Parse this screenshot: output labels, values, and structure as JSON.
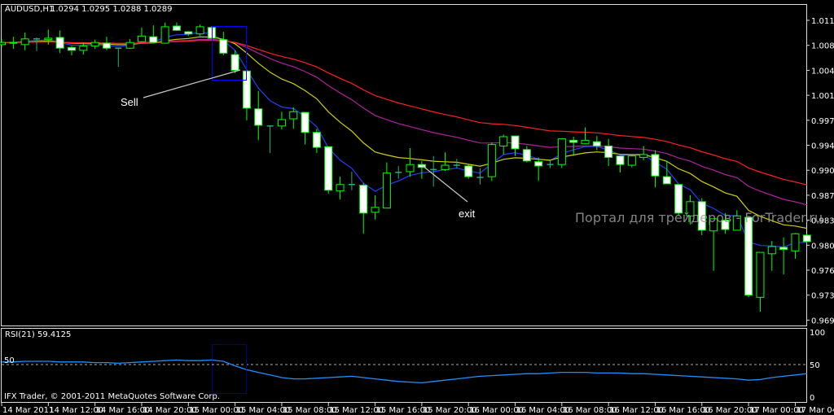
{
  "header": {
    "symbol": "AUDUSD,H1",
    "quote": "1.0294 1.0295 1.0288 1.0289"
  },
  "annotations": {
    "sell": "Sell",
    "exit": "exit"
  },
  "watermark": "Портал для трейдеров - ForTrader.ru",
  "copyright": "IFX Trader, © 2001-2011 MetaQuotes Software Corp.",
  "rsi_panel": {
    "label": "RSI(21) 59.4125",
    "level_label": "50",
    "axis": [
      "100",
      "50",
      "0"
    ]
  },
  "colors": {
    "bull": "#00ff00",
    "bear_fill": "#ffffff",
    "doji": "#20b080",
    "ma_fast": "#2040ff",
    "ma_mid": "#d0d000",
    "ma_slow": "#ff2020",
    "ma_slower": "#b020a0",
    "rsi": "#1e90ff",
    "box": "#0000ff"
  },
  "chart_data": {
    "type": "candlestick",
    "title": "AUDUSD,H1",
    "ylim": [
      0.968,
      1.0135
    ],
    "y_ticks": [
      "1.0115",
      "1.0080",
      "1.0045",
      "1.0010",
      "0.9975",
      "0.9940",
      "0.9905",
      "0.9870",
      "0.9835",
      "0.9800",
      "0.9765",
      "0.9730",
      "0.9695"
    ],
    "x_ticks": [
      "14 Mar 2011",
      "14 Mar 12:00",
      "14 Mar 16:00",
      "14 Mar 20:00",
      "15 Mar 00:00",
      "15 Mar 04:00",
      "15 Mar 08:00",
      "15 Mar 12:00",
      "15 Mar 16:00",
      "15 Mar 20:00",
      "16 Mar 00:00",
      "16 Mar 04:00",
      "16 Mar 08:00",
      "16 Mar 12:00",
      "16 Mar 16:00",
      "16 Mar 20:00",
      "17 Mar 00:00",
      "17 Mar 04:00"
    ],
    "bars_per_tick": 4,
    "ohlc": [
      [
        1.0081,
        1.0089,
        1.0077,
        1.0084
      ],
      [
        1.0083,
        1.0092,
        1.0075,
        1.0084
      ],
      [
        1.0081,
        1.0098,
        1.0073,
        1.0089
      ],
      [
        1.0089,
        1.0091,
        1.0072,
        1.0089
      ],
      [
        1.0088,
        1.0102,
        1.0081,
        1.009
      ],
      [
        1.0091,
        1.0101,
        1.0069,
        1.0076
      ],
      [
        1.0077,
        1.0079,
        1.0066,
        1.0073
      ],
      [
        1.0073,
        1.0084,
        1.0067,
        1.0079
      ],
      [
        1.0079,
        1.0088,
        1.0075,
        1.0084
      ],
      [
        1.0083,
        1.0092,
        1.0073,
        1.0076
      ],
      [
        1.0076,
        1.0076,
        1.005,
        1.0076
      ],
      [
        1.0076,
        1.0089,
        1.0075,
        1.0084
      ],
      [
        1.0085,
        1.0105,
        1.0084,
        1.0093
      ],
      [
        1.0092,
        1.0108,
        1.0083,
        1.0084
      ],
      [
        1.0083,
        1.0112,
        1.0083,
        1.0106
      ],
      [
        1.0107,
        1.0112,
        1.01,
        1.0101
      ],
      [
        1.0099,
        1.01,
        1.0093,
        1.0096
      ],
      [
        1.0096,
        1.0109,
        1.0093,
        1.0106
      ],
      [
        1.0105,
        1.0107,
        1.0089,
        1.009
      ],
      [
        1.0088,
        1.0099,
        1.0066,
        1.0069
      ],
      [
        1.0067,
        1.0073,
        1.0041,
        1.0045
      ],
      [
        1.0044,
        1.0044,
        0.9975,
        0.9992
      ],
      [
        0.9991,
        1.0016,
        0.9947,
        0.9968
      ],
      [
        0.9967,
        0.9967,
        0.9929,
        0.9967
      ],
      [
        0.9967,
        0.9987,
        0.9962,
        0.9976
      ],
      [
        0.9977,
        0.9993,
        0.9963,
        0.9987
      ],
      [
        0.9986,
        0.9986,
        0.9941,
        0.9958
      ],
      [
        0.9958,
        0.9963,
        0.9929,
        0.9937
      ],
      [
        0.9938,
        0.9938,
        0.9872,
        0.9877
      ],
      [
        0.9876,
        0.9896,
        0.9864,
        0.9885
      ],
      [
        0.9885,
        0.9903,
        0.9877,
        0.9885
      ],
      [
        0.9884,
        0.9887,
        0.9816,
        0.9845
      ],
      [
        0.9846,
        0.987,
        0.9836,
        0.9853
      ],
      [
        0.9852,
        0.9916,
        0.9852,
        0.9901
      ],
      [
        0.9902,
        0.9911,
        0.9893,
        0.9902
      ],
      [
        0.9903,
        0.9936,
        0.9896,
        0.9913
      ],
      [
        0.9913,
        0.9918,
        0.9893,
        0.9909
      ],
      [
        0.9906,
        0.9925,
        0.9882,
        0.9906
      ],
      [
        0.9906,
        0.993,
        0.9904,
        0.9912
      ],
      [
        0.9912,
        0.9921,
        0.9908,
        0.9912
      ],
      [
        0.9911,
        0.9913,
        0.9893,
        0.9896
      ],
      [
        0.9895,
        0.9908,
        0.9885,
        0.9895
      ],
      [
        0.9896,
        0.9944,
        0.989,
        0.9941
      ],
      [
        0.9939,
        0.9955,
        0.9927,
        0.9952
      ],
      [
        0.9953,
        0.9953,
        0.9925,
        0.9935
      ],
      [
        0.9934,
        0.9939,
        0.9916,
        0.9918
      ],
      [
        0.9917,
        0.9923,
        0.989,
        0.9911
      ],
      [
        0.9913,
        0.9919,
        0.9908,
        0.9913
      ],
      [
        0.9913,
        0.995,
        0.9908,
        0.9949
      ],
      [
        0.9947,
        0.9952,
        0.9925,
        0.9944
      ],
      [
        0.9942,
        0.9965,
        0.9942,
        0.9947
      ],
      [
        0.9945,
        0.9953,
        0.9933,
        0.9939
      ],
      [
        0.9939,
        0.9949,
        0.9911,
        0.9923
      ],
      [
        0.9925,
        0.9925,
        0.9902,
        0.9913
      ],
      [
        0.9912,
        0.9925,
        0.9909,
        0.9925
      ],
      [
        0.9923,
        0.9939,
        0.9919,
        0.9927
      ],
      [
        0.9927,
        0.9933,
        0.9881,
        0.9897
      ],
      [
        0.9896,
        0.9918,
        0.9886,
        0.9886
      ],
      [
        0.9885,
        0.9885,
        0.9841,
        0.9845
      ],
      [
        0.9841,
        0.987,
        0.9829,
        0.9861
      ],
      [
        0.9861,
        0.9866,
        0.9814,
        0.9821
      ],
      [
        0.982,
        0.9837,
        0.9764,
        0.9837
      ],
      [
        0.9835,
        0.9845,
        0.9816,
        0.9822
      ],
      [
        0.9821,
        0.9849,
        0.9821,
        0.9841
      ],
      [
        0.9839,
        0.9841,
        0.9727,
        0.973
      ],
      [
        0.9727,
        0.979,
        0.9707,
        0.979
      ],
      [
        0.9788,
        0.9806,
        0.9764,
        0.9798
      ],
      [
        0.9797,
        0.9811,
        0.9759,
        0.9794
      ],
      [
        0.9792,
        0.9817,
        0.9781,
        0.9816
      ],
      [
        0.9814,
        0.9816,
        0.9805,
        0.9805
      ]
    ],
    "moving_averages": [
      {
        "period": 5,
        "color_key": "ma_fast"
      },
      {
        "period": 13,
        "color_key": "ma_mid"
      },
      {
        "period": 26,
        "color_key": "ma_slower"
      },
      {
        "period": 40,
        "color_key": "ma_slow"
      }
    ],
    "rsi": {
      "period": 21,
      "ylim": [
        0,
        100
      ],
      "level": 50,
      "values": [
        54,
        54,
        55,
        55,
        55,
        54,
        54,
        54,
        53,
        53,
        52,
        53,
        54,
        55,
        56,
        57,
        56,
        56,
        57,
        55,
        48,
        42,
        38,
        34,
        30,
        28,
        28,
        29,
        30,
        31,
        32,
        30,
        28,
        26,
        24,
        23,
        22,
        24,
        26,
        28,
        30,
        32,
        33,
        34,
        35,
        36,
        36,
        37,
        38,
        38,
        38,
        37,
        37,
        37,
        36,
        36,
        35,
        34,
        33,
        32,
        31,
        30,
        29,
        28,
        26,
        27,
        30,
        32,
        34,
        36
      ]
    }
  }
}
